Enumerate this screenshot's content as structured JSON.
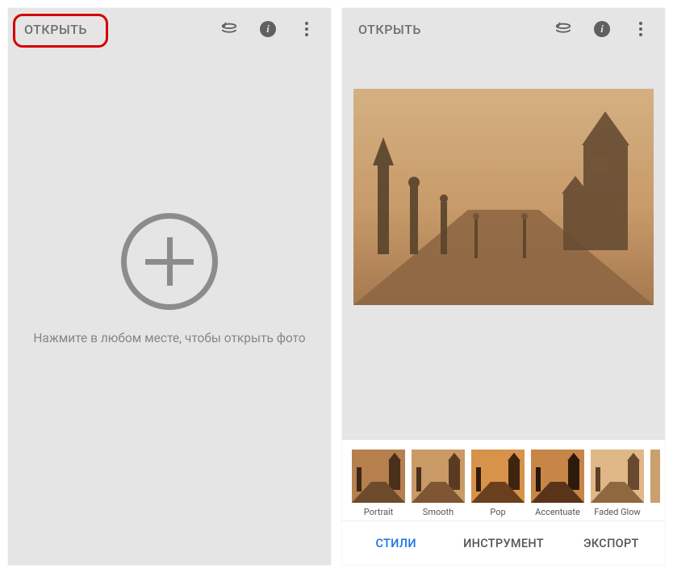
{
  "left": {
    "open_label": "ОТКРЫТЬ",
    "hint": "Нажмите в любом месте, чтобы открыть фото"
  },
  "right": {
    "open_label": "ОТКРЫТЬ",
    "styles": [
      {
        "label": "Portrait"
      },
      {
        "label": "Smooth"
      },
      {
        "label": "Pop"
      },
      {
        "label": "Accentuate"
      },
      {
        "label": "Faded Glow"
      }
    ],
    "tabs": {
      "styles": "СТИЛИ",
      "tools": "ИНСТРУМЕНТ",
      "export": "ЭКСПОРТ"
    }
  },
  "icons": {
    "layers": "layers-icon",
    "info": "info-icon",
    "more": "more-icon",
    "plus": "plus-icon"
  },
  "colors": {
    "highlight": "#d40000",
    "active_tab": "#1a73e8",
    "bg": "#e5e5e5"
  }
}
